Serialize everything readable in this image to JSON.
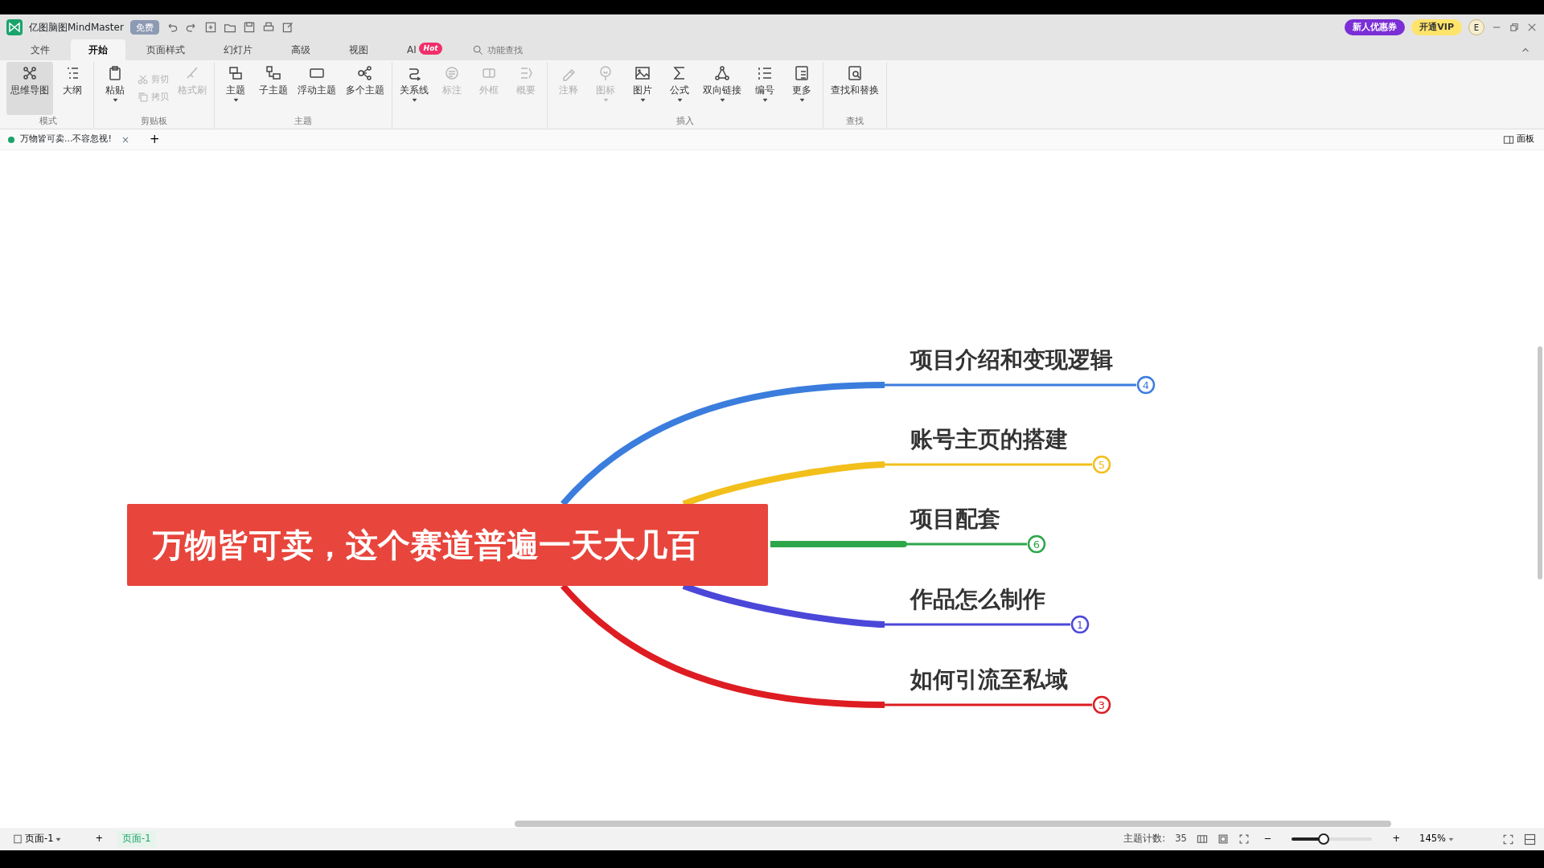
{
  "app": {
    "name": "亿图脑图MindMaster",
    "badge": "免费",
    "promo": "新人优惠券",
    "vip": "开通VIP",
    "avatar": "E"
  },
  "menu_tabs": [
    {
      "label": "文件",
      "selected": false
    },
    {
      "label": "开始",
      "selected": true
    },
    {
      "label": "页面样式",
      "selected": false
    },
    {
      "label": "幻灯片",
      "selected": false
    },
    {
      "label": "高级",
      "selected": false
    },
    {
      "label": "视图",
      "selected": false
    },
    {
      "label": "AI",
      "selected": false,
      "badge": "Hot"
    }
  ],
  "search": {
    "placeholder": "功能查找"
  },
  "ribbon": [
    {
      "label": "模式",
      "items": [
        {
          "label": "思维导图",
          "selected": true,
          "disabled": false,
          "dropdown": false
        },
        {
          "label": "大纲",
          "selected": false,
          "disabled": false,
          "dropdown": false
        }
      ]
    },
    {
      "label": "剪贴板",
      "items": [
        {
          "label": "粘贴",
          "disabled": false,
          "dropdown": true
        },
        {
          "label": "剪切",
          "disabled": true,
          "dropdown": false,
          "kind": "small"
        },
        {
          "label": "拷贝",
          "disabled": true,
          "dropdown": false,
          "kind": "small"
        },
        {
          "label": "格式刷",
          "disabled": true,
          "dropdown": false
        }
      ]
    },
    {
      "label": "主题",
      "items": [
        {
          "label": "主题",
          "disabled": false,
          "dropdown": true
        },
        {
          "label": "子主题",
          "disabled": false,
          "dropdown": false
        },
        {
          "label": "浮动主题",
          "disabled": false,
          "dropdown": false
        },
        {
          "label": "多个主题",
          "disabled": false,
          "dropdown": false
        }
      ]
    },
    {
      "items": [
        {
          "label": "关系线",
          "disabled": false,
          "dropdown": true
        },
        {
          "label": "标注",
          "disabled": true,
          "dropdown": false
        },
        {
          "label": "外框",
          "disabled": true,
          "dropdown": false
        },
        {
          "label": "概要",
          "disabled": true,
          "dropdown": false
        }
      ]
    },
    {
      "label": "插入",
      "items": [
        {
          "label": "注释",
          "disabled": true,
          "dropdown": false
        },
        {
          "label": "图标",
          "disabled": true,
          "dropdown": true
        },
        {
          "label": "图片",
          "disabled": false,
          "dropdown": true
        },
        {
          "label": "公式",
          "disabled": false,
          "dropdown": true
        },
        {
          "label": "双向链接",
          "disabled": false,
          "dropdown": true
        },
        {
          "label": "编号",
          "disabled": false,
          "dropdown": true
        },
        {
          "label": "更多",
          "disabled": false,
          "dropdown": true
        }
      ]
    },
    {
      "label": "查找",
      "items": [
        {
          "label": "查找和替换",
          "disabled": false,
          "dropdown": false
        }
      ]
    }
  ],
  "doc_tab": {
    "title": "万物皆可卖...不容忽视!",
    "close": "×",
    "add": "+"
  },
  "panel_button": "面板",
  "mind_map": {
    "central": "万物皆可卖，这个赛道普遍一天大几百",
    "branches": [
      {
        "label": "项目介绍和变现逻辑",
        "count": "4",
        "color": "#3b7ddd"
      },
      {
        "label": "账号主页的搭建",
        "count": "5",
        "color": "#f2bf1b"
      },
      {
        "label": "项目配套",
        "count": "6",
        "color": "#2ea64a"
      },
      {
        "label": "作品怎么制作",
        "count": "1",
        "color": "#4b47d9"
      },
      {
        "label": "如何引流至私域",
        "count": "3",
        "color": "#dd1d22"
      }
    ]
  },
  "status_bar": {
    "page_menu": "页面-1",
    "add": "+",
    "pages": [
      {
        "label": "页面-1",
        "selected": true
      }
    ],
    "topic_count_label": "主题计数:",
    "topic_count": "35",
    "zoom_out": "−",
    "zoom_in": "+",
    "zoom_slider": {
      "level": 0.4
    },
    "zoom": "145%"
  }
}
